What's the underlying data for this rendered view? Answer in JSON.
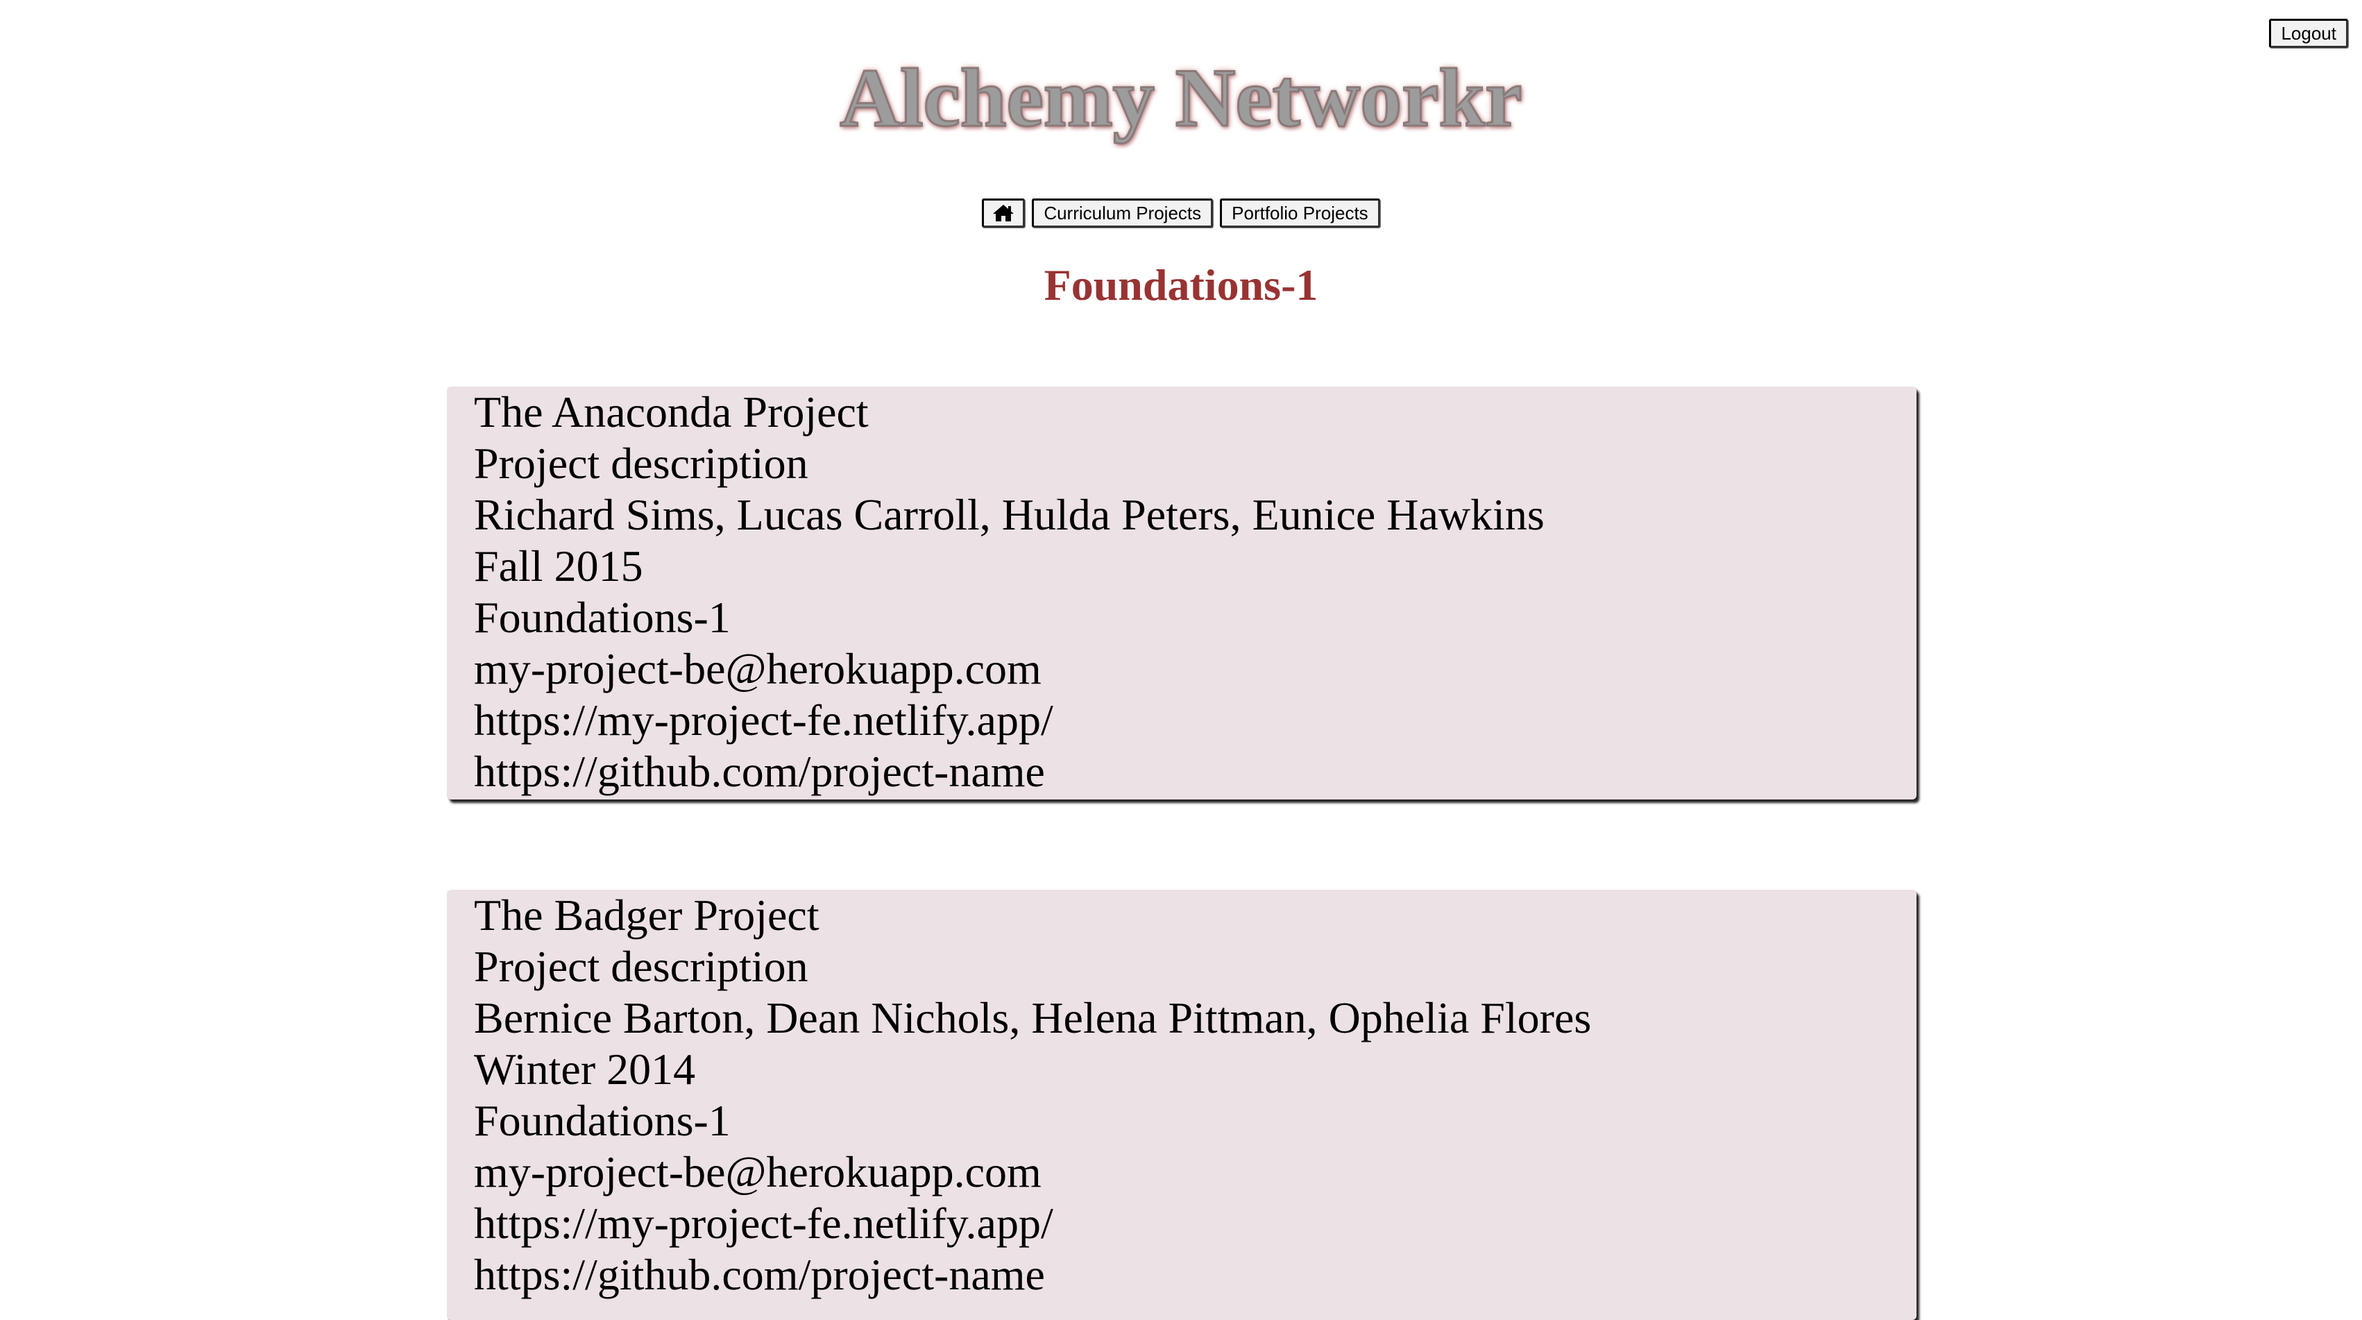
{
  "header": {
    "title": "Alchemy Networkr",
    "logout_label": "Logout"
  },
  "nav": {
    "home_icon": "home-icon",
    "curriculum_label": "Curriculum Projects",
    "portfolio_label": "Portfolio Projects"
  },
  "section": {
    "heading": "Foundations-1",
    "heading_color": "#993333"
  },
  "colors": {
    "card_background": "#ece1e4",
    "title_fill": "#9c9c9c",
    "title_glow": "#d49a9a"
  },
  "projects": [
    {
      "name": "The Anaconda Project",
      "description": "Project description",
      "members": "Richard Sims, Lucas Carroll, Hulda Peters, Eunice Hawkins",
      "cohort": "Fall 2015",
      "curriculum": "Foundations-1",
      "backend": "my-project-be@herokuapp.com",
      "frontend": "https://my-project-fe.netlify.app/",
      "github": "https://github.com/project-name"
    },
    {
      "name": "The Badger Project",
      "description": "Project description",
      "members": "Bernice Barton, Dean Nichols, Helena Pittman, Ophelia Flores",
      "cohort": "Winter 2014",
      "curriculum": "Foundations-1",
      "backend": "my-project-be@herokuapp.com",
      "frontend": "https://my-project-fe.netlify.app/",
      "github": "https://github.com/project-name"
    }
  ]
}
